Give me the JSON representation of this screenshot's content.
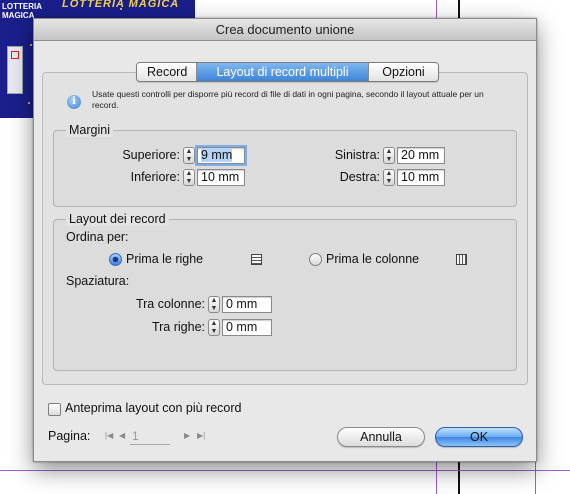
{
  "background": {
    "poster_title_line1": "LOTTERIA",
    "poster_title_line2": "MAGICA",
    "poster_banner": "LOTTERIA MAGICA"
  },
  "dialog": {
    "title": "Crea documento unione",
    "tabs": [
      {
        "label": "Record",
        "active": false
      },
      {
        "label": "Layout di record multipli",
        "active": true
      },
      {
        "label": "Opzioni",
        "active": false
      }
    ],
    "info_text": "Usate questi controlli per disporre più record di file di dati in ogni pagina, secondo il layout attuale per un record.",
    "margins": {
      "legend": "Margini",
      "top_label": "Superiore:",
      "top_value": "9 mm",
      "bottom_label": "Inferiore:",
      "bottom_value": "10 mm",
      "left_label": "Sinistra:",
      "left_value": "20 mm",
      "right_label": "Destra:",
      "right_value": "10 mm"
    },
    "record_layout": {
      "legend": "Layout dei record",
      "order_label": "Ordina per:",
      "rows_first_label": "Prima le righe",
      "rows_first_selected": true,
      "columns_first_label": "Prima le colonne",
      "columns_first_selected": false,
      "spacing_label": "Spaziatura:",
      "column_gap_label": "Tra colonne:",
      "column_gap_value": "0 mm",
      "row_gap_label": "Tra righe:",
      "row_gap_value": "0 mm"
    },
    "preview_label": "Anteprima layout con più record",
    "preview_checked": false,
    "page_label": "Pagina:",
    "page_value": "1",
    "cancel_label": "Annulla",
    "ok_label": "OK"
  }
}
